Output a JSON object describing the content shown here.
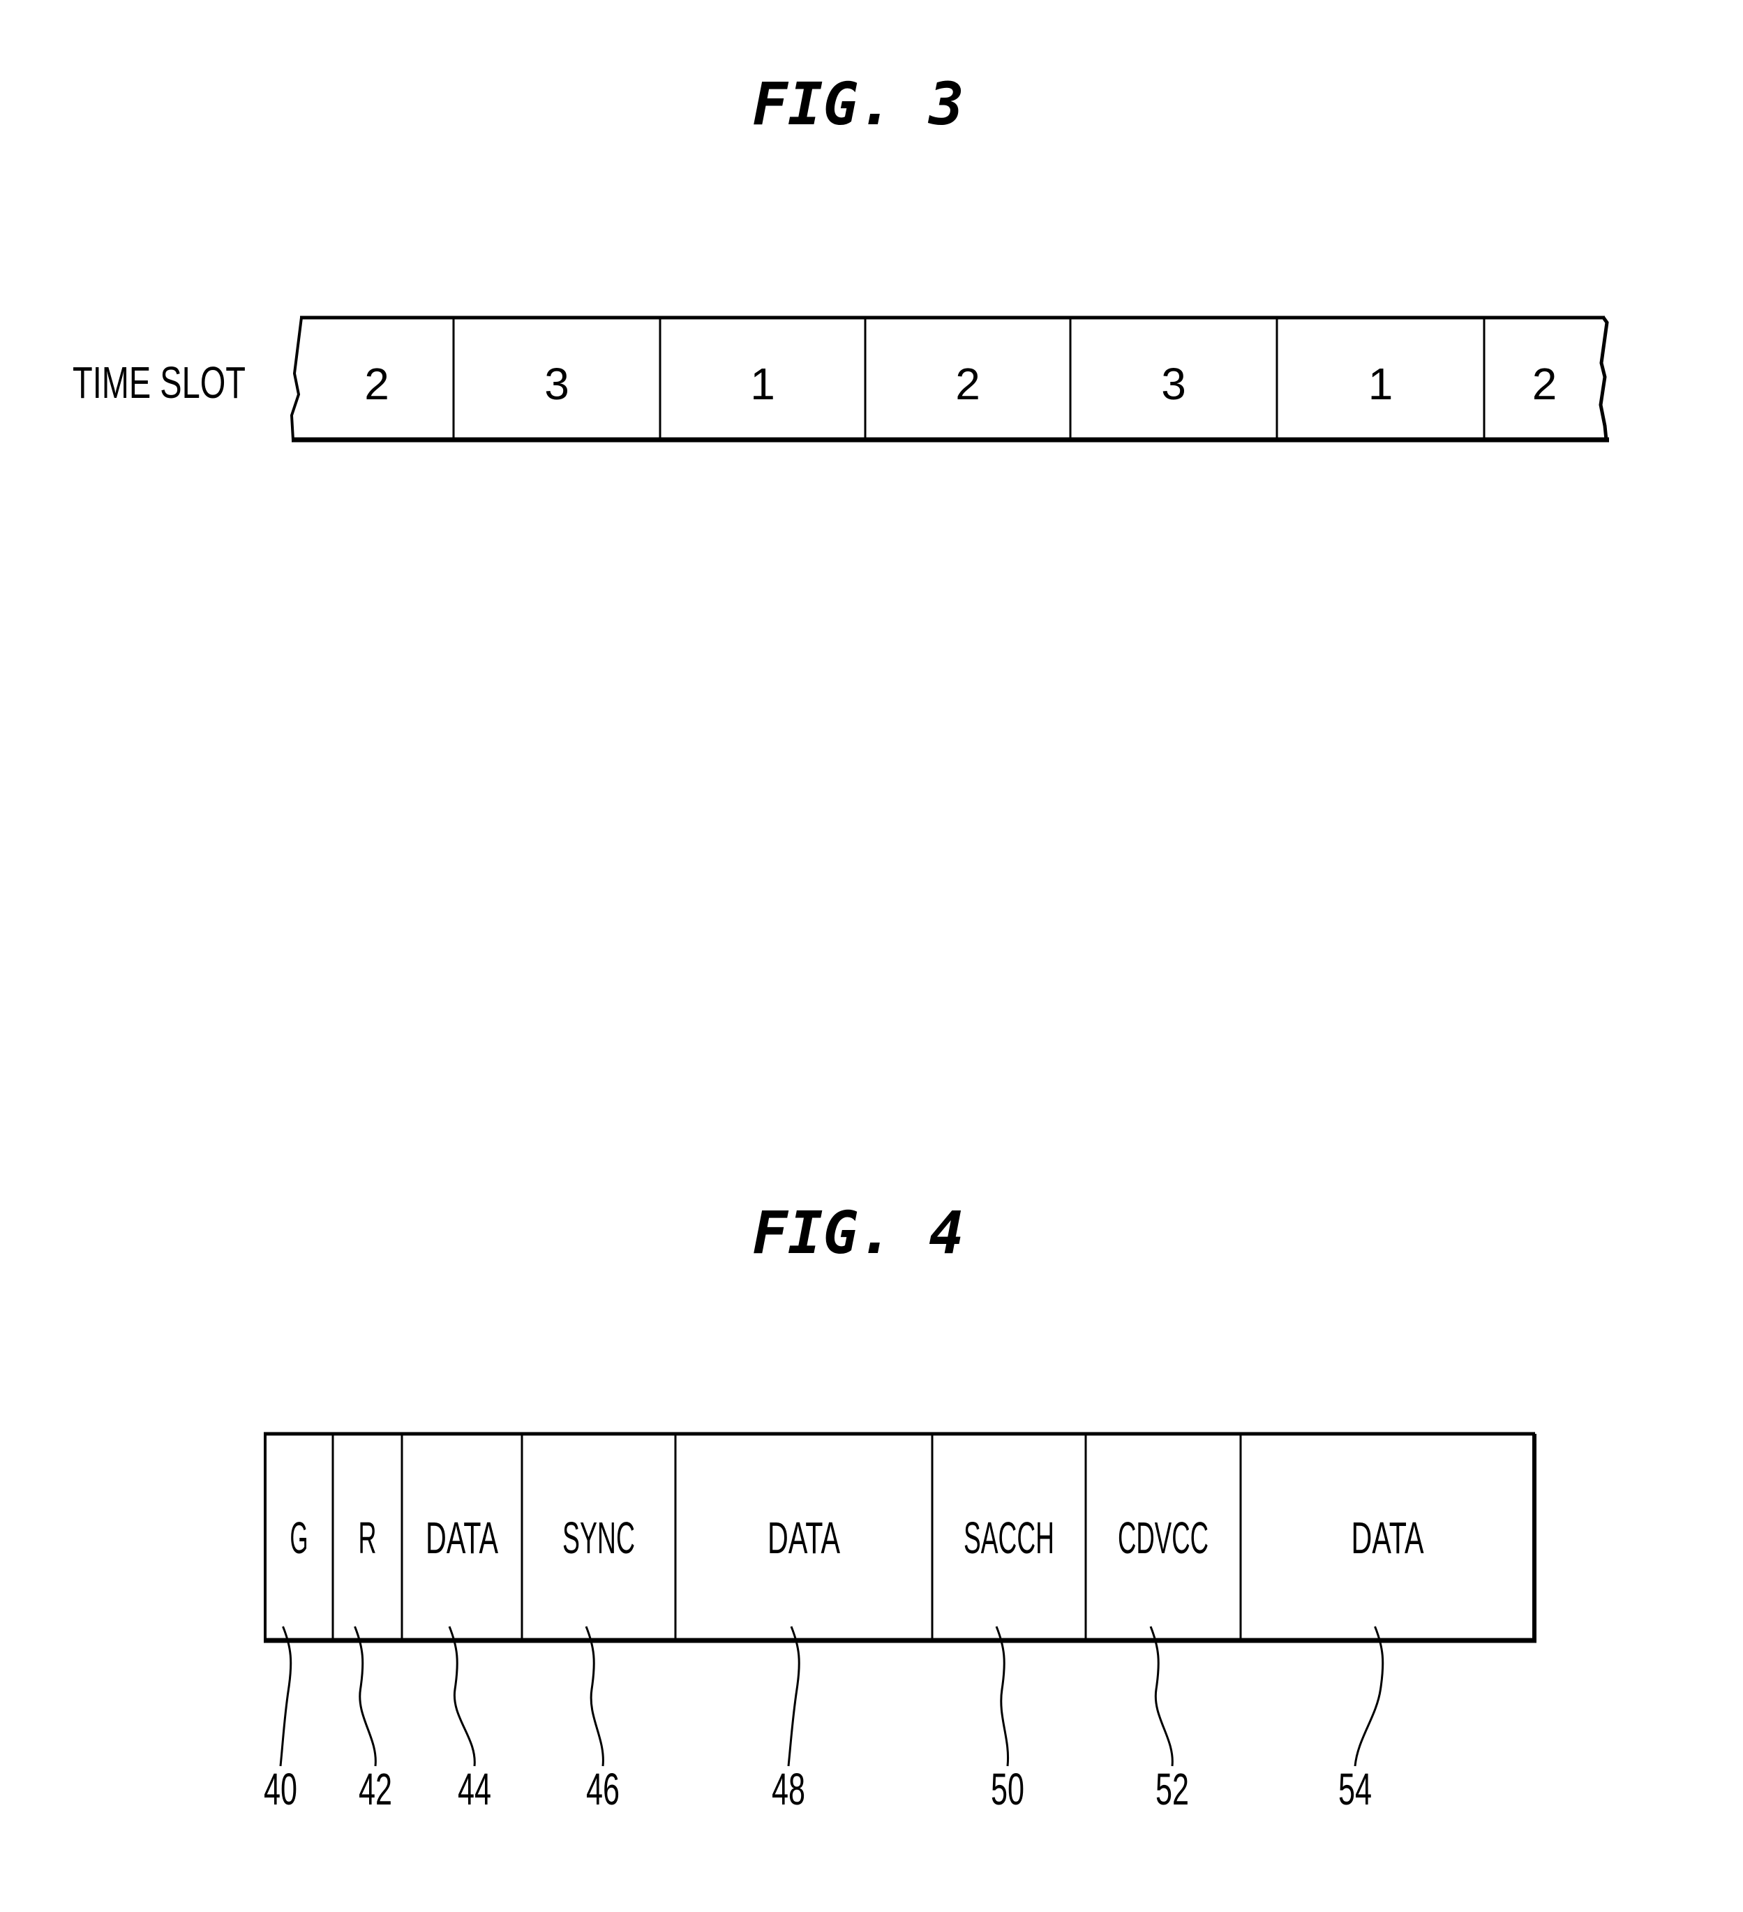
{
  "fig3": {
    "title": "FIG. 3",
    "row_label": "TIME SLOT",
    "slots": [
      "2",
      "3",
      "1",
      "2",
      "3",
      "1",
      "2"
    ]
  },
  "fig4": {
    "title": "FIG. 4",
    "fields": [
      {
        "label": "G",
        "ref": "40"
      },
      {
        "label": "R",
        "ref": "42"
      },
      {
        "label": "DATA",
        "ref": "44"
      },
      {
        "label": "SYNC",
        "ref": "46"
      },
      {
        "label": "DATA",
        "ref": "48"
      },
      {
        "label": "SACCH",
        "ref": "50"
      },
      {
        "label": "CDVCC",
        "ref": "52"
      },
      {
        "label": "DATA",
        "ref": "54"
      }
    ]
  }
}
